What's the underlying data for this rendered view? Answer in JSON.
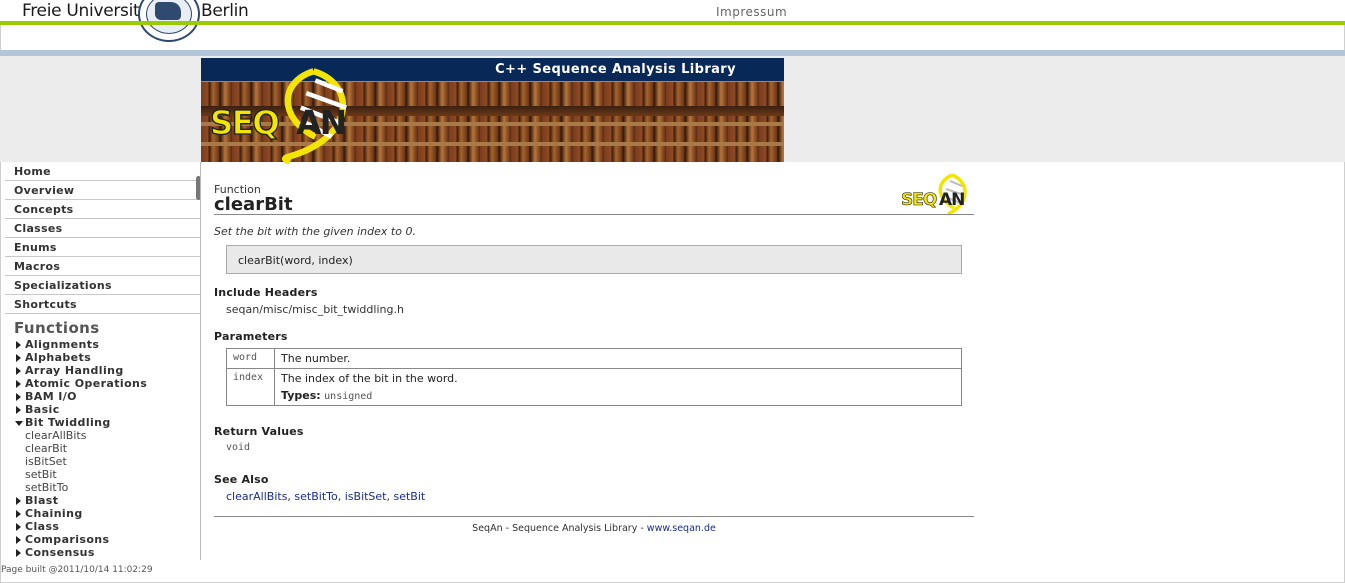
{
  "header": {
    "university_left": "Freie Universität",
    "university_right": "Berlin",
    "impressum": "Impressum"
  },
  "banner": {
    "title": "C++ Sequence Analysis Library"
  },
  "sidebar": {
    "items": [
      {
        "label": "Home"
      },
      {
        "label": "Overview"
      },
      {
        "label": "Concepts"
      },
      {
        "label": "Classes"
      },
      {
        "label": "Enums"
      },
      {
        "label": "Macros"
      },
      {
        "label": "Specializations"
      },
      {
        "label": "Shortcuts"
      }
    ],
    "functions_heading": "Functions",
    "categories_top": [
      "Alignments",
      "Alphabets",
      "Array Handling",
      "Atomic Operations",
      "BAM I/O",
      "Basic"
    ],
    "open_category": "Bit Twiddling",
    "open_children": [
      "clearAllBits",
      "clearBit",
      "isBitSet",
      "setBit",
      "setBitTo"
    ],
    "categories_bottom": [
      "Blast",
      "Chaining",
      "Class",
      "Comparisons",
      "Consensus"
    ]
  },
  "page_built": "Page built @2011/10/14 11:02:29",
  "doc": {
    "kind": "Function",
    "name": "clearBit",
    "summary": "Set the bit with the given index to 0.",
    "signature": "clearBit(word, index)",
    "include_heading": "Include Headers",
    "include_value": "seqan/misc/misc_bit_twiddling.h",
    "params_heading": "Parameters",
    "params": [
      {
        "name": "word",
        "desc": "The number."
      },
      {
        "name": "index",
        "desc": "The index of the bit in the word.",
        "types_label": "Types:",
        "types": "unsigned"
      }
    ],
    "return_heading": "Return Values",
    "return_value": "void",
    "see_also_heading": "See Also",
    "see_also": [
      "clearAllBits",
      "setBitTo",
      "isBitSet",
      "setBit"
    ],
    "footer_text": "SeqAn - Sequence Analysis Library - ",
    "footer_link": "www.seqan.de"
  },
  "colors": {
    "accent_green": "#99cc00",
    "banner_navy": "#082958",
    "link_blue": "#1a2c8a",
    "logo_yellow": "#f2e600"
  }
}
